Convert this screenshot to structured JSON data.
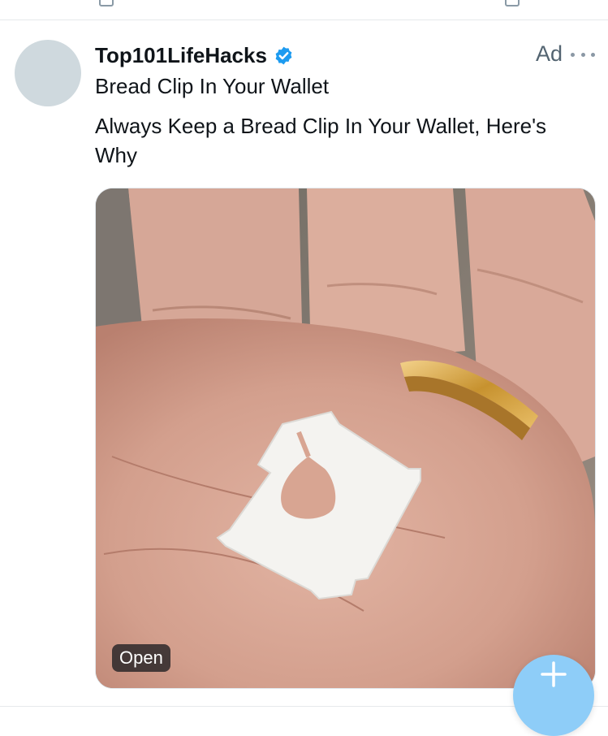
{
  "post": {
    "author": "Top101LifeHacks",
    "headline": "Bread Clip In Your Wallet",
    "text": "Always Keep a Bread Clip In Your Wallet, Here's Why",
    "ad_label": "Ad",
    "media_open_label": "Open"
  },
  "icons": {
    "verified": "verified-badge-icon",
    "more": "more-options-icon",
    "compose": "plus-icon"
  },
  "colors": {
    "verified": "#1d9bf0",
    "fab": "#8ecdf8",
    "secondary_text": "#536471"
  }
}
